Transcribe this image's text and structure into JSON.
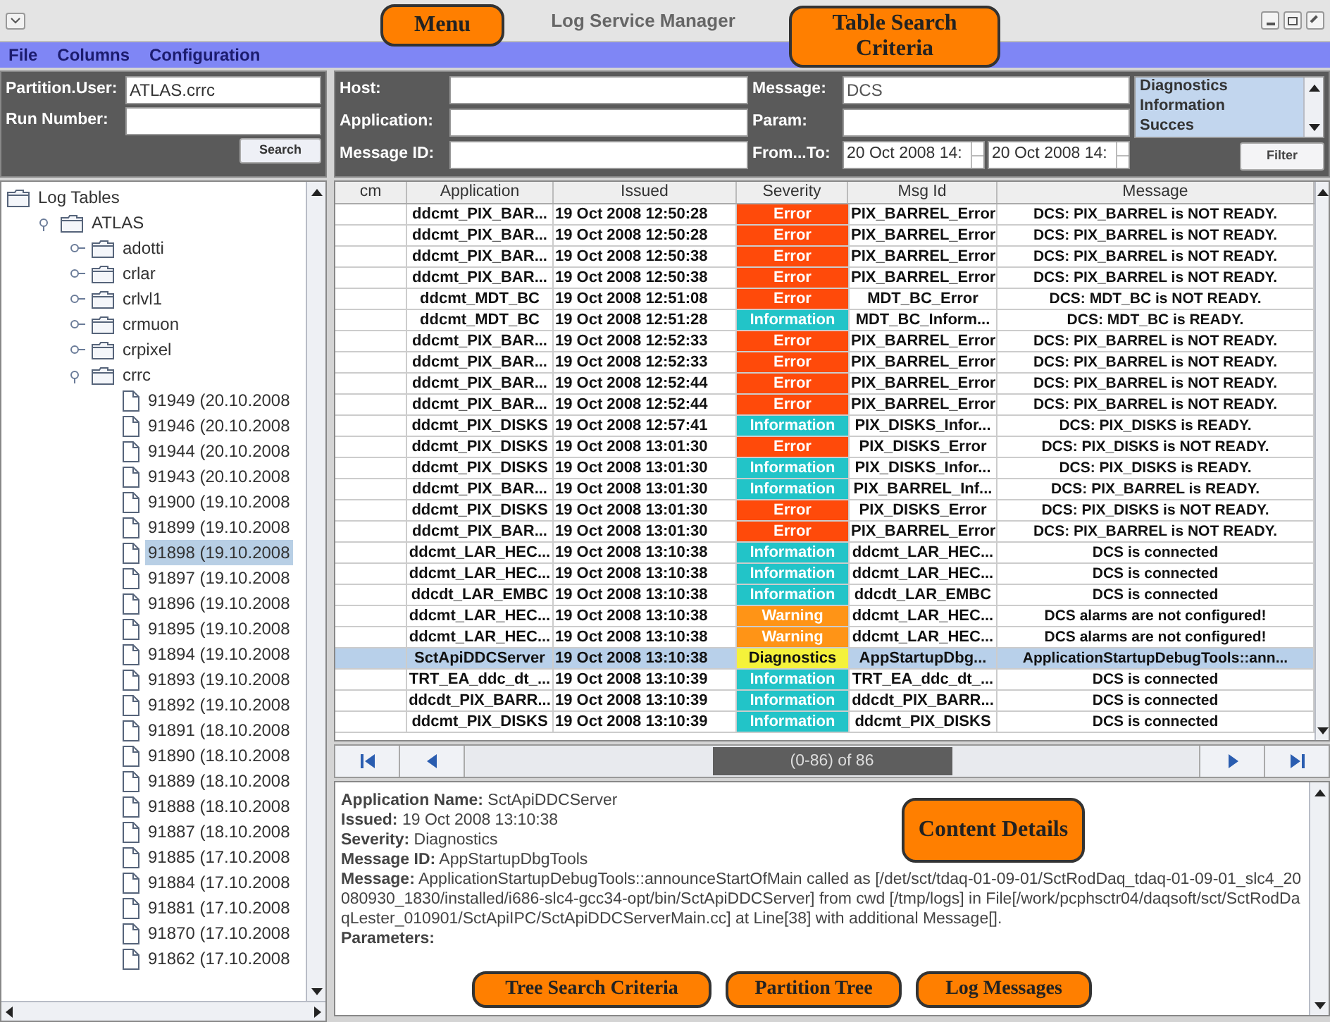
{
  "window": {
    "title": "Log Service Manager"
  },
  "menu": [
    "File",
    "Columns",
    "Configuration"
  ],
  "tree_search": {
    "fields": [
      {
        "label": "Partition.User:",
        "value": "ATLAS.crrc"
      },
      {
        "label": "Run Number:"
      }
    ],
    "button": "Search"
  },
  "table_search": {
    "fields": [
      {
        "label": "Host:"
      },
      {
        "label": "Application:"
      },
      {
        "label": "Message ID:"
      }
    ],
    "fields_2": [
      {
        "label": "Message:",
        "value": "DCS"
      },
      {
        "label": "Param:"
      }
    ],
    "range": {
      "label": "From...To:",
      "from": "20 Oct 2008 14:",
      "to": "20 Oct 2008 14:"
    },
    "severity_list": [
      "Diagnostics",
      "Information",
      "Succes"
    ],
    "button": "Filter"
  },
  "tree": {
    "label": "Log Tables",
    "kind": "root",
    "selected": false,
    "children": [
      {
        "label": "ATLAS",
        "kind": "folder",
        "expanded": true,
        "selected": false,
        "children": [
          {
            "label": "adotti",
            "kind": "folder",
            "expanded": false,
            "selected": false
          },
          {
            "label": "crlar",
            "kind": "folder",
            "expanded": false,
            "selected": false
          },
          {
            "label": "crlvl1",
            "kind": "folder",
            "expanded": false,
            "selected": false
          },
          {
            "label": "crmuon",
            "kind": "folder",
            "expanded": false,
            "selected": false
          },
          {
            "label": "crpixel",
            "kind": "folder",
            "expanded": false,
            "selected": false
          },
          {
            "label": "crrc",
            "kind": "folder",
            "expanded": true,
            "selected": false,
            "children": [
              {
                "label": "91949 (20.10.2008",
                "kind": "file",
                "selected": false
              },
              {
                "label": "91946 (20.10.2008",
                "kind": "file",
                "selected": false
              },
              {
                "label": "91944 (20.10.2008",
                "kind": "file",
                "selected": false
              },
              {
                "label": "91943 (20.10.2008",
                "kind": "file",
                "selected": false
              },
              {
                "label": "91900 (19.10.2008",
                "kind": "file",
                "selected": false
              },
              {
                "label": "91899 (19.10.2008",
                "kind": "file",
                "selected": false
              },
              {
                "label": "91898 (19.10.2008",
                "kind": "file",
                "selected": true
              },
              {
                "label": "91897 (19.10.2008",
                "kind": "file",
                "selected": false
              },
              {
                "label": "91896 (19.10.2008",
                "kind": "file",
                "selected": false
              },
              {
                "label": "91895 (19.10.2008",
                "kind": "file",
                "selected": false
              },
              {
                "label": "91894 (19.10.2008",
                "kind": "file",
                "selected": false
              },
              {
                "label": "91893 (19.10.2008",
                "kind": "file",
                "selected": false
              },
              {
                "label": "91892 (19.10.2008",
                "kind": "file",
                "selected": false
              },
              {
                "label": "91891 (18.10.2008",
                "kind": "file",
                "selected": false
              },
              {
                "label": "91890 (18.10.2008",
                "kind": "file",
                "selected": false
              },
              {
                "label": "91889 (18.10.2008",
                "kind": "file",
                "selected": false
              },
              {
                "label": "91888 (18.10.2008",
                "kind": "file",
                "selected": false
              },
              {
                "label": "91887 (18.10.2008",
                "kind": "file",
                "selected": false
              },
              {
                "label": "91885 (17.10.2008",
                "kind": "file",
                "selected": false
              },
              {
                "label": "91884 (17.10.2008",
                "kind": "file",
                "selected": false
              },
              {
                "label": "91881 (17.10.2008",
                "kind": "file",
                "selected": false
              },
              {
                "label": "91870 (17.10.2008",
                "kind": "file",
                "selected": false
              },
              {
                "label": "91862 (17.10.2008",
                "kind": "file",
                "selected": false
              }
            ]
          }
        ]
      }
    ]
  },
  "table": {
    "columns": [
      "cm",
      "Application",
      "Issued",
      "Severity",
      "Msg Id",
      "Message"
    ],
    "rows": [
      {
        "application": "ddcmt_PIX_BAR...",
        "issued": "19 Oct 2008 12:50:28",
        "severity": "Error",
        "color": "#ff4a0a",
        "msg_id": "PIX_BARREL_Error",
        "message": "DCS: PIX_BARREL is NOT READY.",
        "selected": false
      },
      {
        "application": "ddcmt_PIX_BAR...",
        "issued": "19 Oct 2008 12:50:28",
        "severity": "Error",
        "color": "#ff4a0a",
        "msg_id": "PIX_BARREL_Error",
        "message": "DCS: PIX_BARREL is NOT READY.",
        "selected": false
      },
      {
        "application": "ddcmt_PIX_BAR...",
        "issued": "19 Oct 2008 12:50:38",
        "severity": "Error",
        "color": "#ff4a0a",
        "msg_id": "PIX_BARREL_Error",
        "message": "DCS: PIX_BARREL is NOT READY.",
        "selected": false
      },
      {
        "application": "ddcmt_PIX_BAR...",
        "issued": "19 Oct 2008 12:50:38",
        "severity": "Error",
        "color": "#ff4a0a",
        "msg_id": "PIX_BARREL_Error",
        "message": "DCS: PIX_BARREL is NOT READY.",
        "selected": false
      },
      {
        "application": "ddcmt_MDT_BC",
        "issued": "19 Oct 2008 12:51:08",
        "severity": "Error",
        "color": "#ff4a0a",
        "msg_id": "MDT_BC_Error",
        "message": "DCS: MDT_BC is NOT READY.",
        "selected": false
      },
      {
        "application": "ddcmt_MDT_BC",
        "issued": "19 Oct 2008 12:51:28",
        "severity": "Information",
        "color": "#22c4c8",
        "msg_id": "MDT_BC_Inform...",
        "message": "DCS: MDT_BC is READY.",
        "selected": false
      },
      {
        "application": "ddcmt_PIX_BAR...",
        "issued": "19 Oct 2008 12:52:33",
        "severity": "Error",
        "color": "#ff4a0a",
        "msg_id": "PIX_BARREL_Error",
        "message": "DCS: PIX_BARREL is NOT READY.",
        "selected": false
      },
      {
        "application": "ddcmt_PIX_BAR...",
        "issued": "19 Oct 2008 12:52:33",
        "severity": "Error",
        "color": "#ff4a0a",
        "msg_id": "PIX_BARREL_Error",
        "message": "DCS: PIX_BARREL is NOT READY.",
        "selected": false
      },
      {
        "application": "ddcmt_PIX_BAR...",
        "issued": "19 Oct 2008 12:52:44",
        "severity": "Error",
        "color": "#ff4a0a",
        "msg_id": "PIX_BARREL_Error",
        "message": "DCS: PIX_BARREL is NOT READY.",
        "selected": false
      },
      {
        "application": "ddcmt_PIX_BAR...",
        "issued": "19 Oct 2008 12:52:44",
        "severity": "Error",
        "color": "#ff4a0a",
        "msg_id": "PIX_BARREL_Error",
        "message": "DCS: PIX_BARREL is NOT READY.",
        "selected": false
      },
      {
        "application": "ddcmt_PIX_DISKS",
        "issued": "19 Oct 2008 12:57:41",
        "severity": "Information",
        "color": "#22c4c8",
        "msg_id": "PIX_DISKS_Infor...",
        "message": "DCS: PIX_DISKS is READY.",
        "selected": false
      },
      {
        "application": "ddcmt_PIX_DISKS",
        "issued": "19 Oct 2008 13:01:30",
        "severity": "Error",
        "color": "#ff4a0a",
        "msg_id": "PIX_DISKS_Error",
        "message": "DCS: PIX_DISKS is NOT READY.",
        "selected": false
      },
      {
        "application": "ddcmt_PIX_DISKS",
        "issued": "19 Oct 2008 13:01:30",
        "severity": "Information",
        "color": "#22c4c8",
        "msg_id": "PIX_DISKS_Infor...",
        "message": "DCS: PIX_DISKS is READY.",
        "selected": false
      },
      {
        "application": "ddcmt_PIX_BAR...",
        "issued": "19 Oct 2008 13:01:30",
        "severity": "Information",
        "color": "#22c4c8",
        "msg_id": "PIX_BARREL_Inf...",
        "message": "DCS: PIX_BARREL is READY.",
        "selected": false
      },
      {
        "application": "ddcmt_PIX_DISKS",
        "issued": "19 Oct 2008 13:01:30",
        "severity": "Error",
        "color": "#ff4a0a",
        "msg_id": "PIX_DISKS_Error",
        "message": "DCS: PIX_DISKS is NOT READY.",
        "selected": false
      },
      {
        "application": "ddcmt_PIX_BAR...",
        "issued": "19 Oct 2008 13:01:30",
        "severity": "Error",
        "color": "#ff4a0a",
        "msg_id": "PIX_BARREL_Error",
        "message": "DCS: PIX_BARREL is NOT READY.",
        "selected": false
      },
      {
        "application": "ddcmt_LAR_HEC...",
        "issued": "19 Oct 2008 13:10:38",
        "severity": "Information",
        "color": "#22c4c8",
        "msg_id": "ddcmt_LAR_HEC...",
        "message": "DCS is connected",
        "selected": false
      },
      {
        "application": "ddcmt_LAR_HEC...",
        "issued": "19 Oct 2008 13:10:38",
        "severity": "Information",
        "color": "#22c4c8",
        "msg_id": "ddcmt_LAR_HEC...",
        "message": "DCS is connected",
        "selected": false
      },
      {
        "application": "ddcdt_LAR_EMBC",
        "issued": "19 Oct 2008 13:10:38",
        "severity": "Information",
        "color": "#22c4c8",
        "msg_id": "ddcdt_LAR_EMBC",
        "message": "DCS is connected",
        "selected": false
      },
      {
        "application": "ddcmt_LAR_HEC...",
        "issued": "19 Oct 2008 13:10:38",
        "severity": "Warning",
        "color": "#ff9416",
        "msg_id": "ddcmt_LAR_HEC...",
        "message": "DCS alarms are not configured!",
        "selected": false
      },
      {
        "application": "ddcmt_LAR_HEC...",
        "issued": "19 Oct 2008 13:10:38",
        "severity": "Warning",
        "color": "#ff9416",
        "msg_id": "ddcmt_LAR_HEC...",
        "message": "DCS alarms are not configured!",
        "selected": false
      },
      {
        "application": "SctApiDDCServer",
        "issued": "19 Oct 2008 13:10:38",
        "severity": "Diagnostics",
        "color": "#f5f23a",
        "msg_id": "AppStartupDbg...",
        "message": "ApplicationStartupDebugTools::ann...",
        "selected": true
      },
      {
        "application": "TRT_EA_ddc_dt_...",
        "issued": "19 Oct 2008 13:10:39",
        "severity": "Information",
        "color": "#22c4c8",
        "msg_id": "TRT_EA_ddc_dt_...",
        "message": "DCS is connected",
        "selected": false
      },
      {
        "application": "ddcdt_PIX_BARR...",
        "issued": "19 Oct 2008 13:10:39",
        "severity": "Information",
        "color": "#22c4c8",
        "msg_id": "ddcdt_PIX_BARR...",
        "message": "DCS is connected",
        "selected": false
      },
      {
        "application": "ddcmt_PIX_DISKS",
        "issued": "19 Oct 2008 13:10:39",
        "severity": "Information",
        "color": "#22c4c8",
        "msg_id": "ddcmt_PIX_DISKS",
        "message": "DCS is connected",
        "selected": false
      }
    ]
  },
  "pager": {
    "range": "(0-86) of 86"
  },
  "details": [
    "**Application Name:** SctApiDDCServer",
    "**Issued:** 19 Oct 2008 13:10:38",
    "**Severity:** Diagnostics",
    "**Message ID:** AppStartupDbgTools",
    "**Message:** ApplicationStartupDebugTools::announceStartOfMain called as [/det/sct/tdaq-01-09-01/SctRodDaq_tdaq-01-09-01_slc4_20080930_1830/installed/i686-slc4-gcc34-opt/bin/SctApiDDCServer] from cwd [/tmp/logs] in File[/work/pcphsctr04/daqsoft/sct/SctRodDaqLester_010901/SctApiIPC/SctApiDDCServerMain.cc] at Line[38] with additional Message[].",
    "**Parameters:**"
  ],
  "callouts": [
    "Menu",
    "Table Search Criteria",
    "Tree Search Criteria",
    "Content Details",
    "Partition Tree",
    "Log Messages"
  ]
}
